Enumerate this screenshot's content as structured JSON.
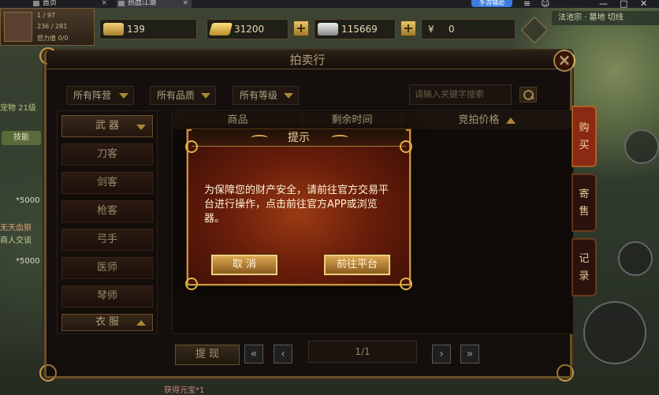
{
  "browser": {
    "tabs": [
      {
        "label": "首页"
      },
      {
        "label": "热血江湖"
      }
    ],
    "pill_label": "手游辅助",
    "window_buttons": [
      "≡",
      "☺",
      "—",
      "□",
      "✕"
    ]
  },
  "hud": {
    "lines": [
      "1 / 97",
      "236 / 281",
      "怒力值 0/0"
    ],
    "currencies": [
      {
        "name": "gold-ingot",
        "value": "139",
        "color": "#d9b24a"
      },
      {
        "name": "gold-bar",
        "value": "31200",
        "color": "#e8c04a"
      },
      {
        "name": "silver-ingot",
        "value": "115669",
        "color": "#c8c8c8"
      },
      {
        "name": "yen",
        "value": "0",
        "symbol": "¥"
      }
    ],
    "map_label": "法池宗 · 墓地   切线",
    "left_texts": [
      "宠物 21级",
      "技能",
      "*5000",
      "无天血狼",
      "商人交谈",
      "*5000"
    ],
    "bottom_texts": [
      "获得元宝*1"
    ]
  },
  "auction": {
    "title": "拍卖行",
    "filters": [
      {
        "label": "所有阵营"
      },
      {
        "label": "所有品质"
      },
      {
        "label": "所有等级"
      }
    ],
    "search_placeholder": "请输入关键字搜索",
    "categories": [
      {
        "label": "武 器",
        "type": "header-down"
      },
      {
        "label": "刀客"
      },
      {
        "label": "剑客"
      },
      {
        "label": "枪客"
      },
      {
        "label": "弓手"
      },
      {
        "label": "医师"
      },
      {
        "label": "琴师"
      },
      {
        "label": "衣 服",
        "type": "header-up"
      }
    ],
    "columns": [
      "商品",
      "剩余时间",
      "竞拍价格"
    ],
    "side_tabs": [
      {
        "label": "购\n买",
        "active": true
      },
      {
        "label": "寄\n售",
        "active": false
      },
      {
        "label": "记\n录",
        "active": false
      }
    ],
    "withdraw_label": "提 现",
    "pager": {
      "first": "«",
      "prev": "‹",
      "page_text": "1/1",
      "next": "›",
      "last": "»"
    }
  },
  "modal": {
    "title": "提示",
    "message": "为保障您的财产安全，请前往官方交易平台进行操作，点击前往官方APP或浏览器。",
    "cancel_label": "取 消",
    "confirm_label": "前往平台"
  },
  "colors": {
    "gold": "#c4953e",
    "modal_red": "#6a1e0a",
    "text_cream": "#e8d5a6"
  }
}
